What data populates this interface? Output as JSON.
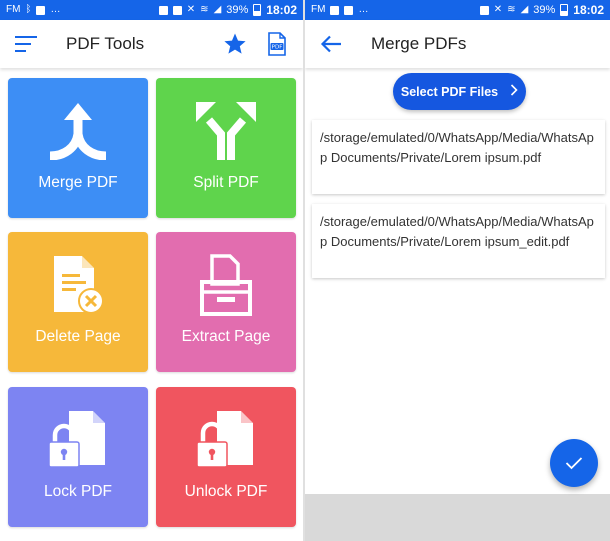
{
  "status": {
    "left_text": "FM",
    "battery": "39%",
    "time": "18:02"
  },
  "left_screen": {
    "title": "PDF Tools",
    "tiles": [
      {
        "label": "Merge PDF",
        "color": "#3d8ef5"
      },
      {
        "label": "Split PDF",
        "color": "#5fd44c"
      },
      {
        "label": "Delete Page",
        "color": "#f6b83a"
      },
      {
        "label": "Extract Page",
        "color": "#e26daf"
      },
      {
        "label": "Lock PDF",
        "color": "#7d84f2"
      },
      {
        "label": "Unlock PDF",
        "color": "#f0555f"
      }
    ]
  },
  "right_screen": {
    "title": "Merge PDFs",
    "select_button": "Select PDF Files",
    "files": [
      "/storage/emulated/0/WhatsApp/Media/WhatsApp Documents/Private/Lorem ipsum.pdf",
      "/storage/emulated/0/WhatsApp/Media/WhatsApp Documents/Private/Lorem ipsum_edit.pdf"
    ]
  },
  "colors": {
    "accent": "#1565e8",
    "divider": "#e0e0e0"
  },
  "icons": {
    "status_left": [
      "fm-radio-icon",
      "bluetooth-icon",
      "image-icon",
      "more-icon"
    ],
    "status_right": [
      "alarm-icon",
      "image-icon",
      "mute-icon",
      "wifi-icon",
      "signal-icon",
      "battery-icon"
    ]
  }
}
